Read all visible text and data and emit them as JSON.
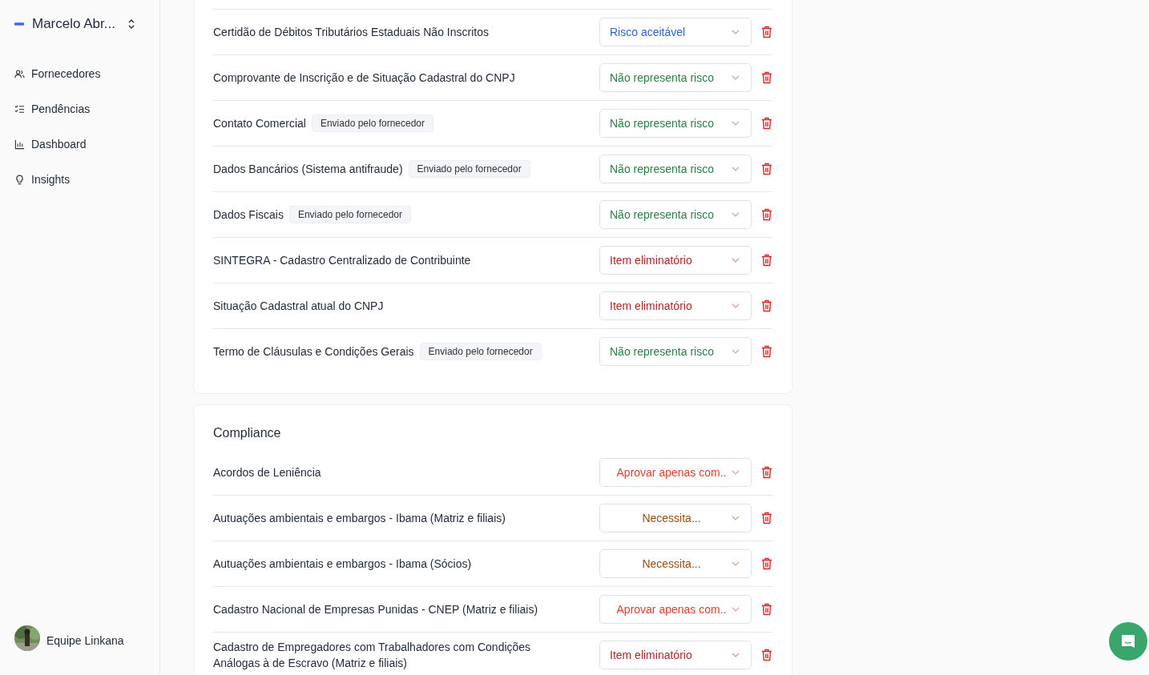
{
  "sidebar": {
    "account": "Marcelo Abr...",
    "items": [
      {
        "label": "Fornecedores",
        "kind": "users",
        "selected": false
      },
      {
        "label": "Pendências",
        "kind": "checklist",
        "selected": false
      },
      {
        "label": "Dashboard",
        "kind": "chart",
        "selected": false
      },
      {
        "label": "Insights",
        "kind": "bulb",
        "selected": false
      }
    ],
    "user": {
      "name": "Equipe Linkana"
    }
  },
  "sections": [
    {
      "items": [
        {
          "name": "Certidão de Débitos Tributários Estaduais Não Inscritos",
          "risk": "Risco aceitável",
          "kind": "acceptable"
        },
        {
          "name": "Comprovante de Inscrição e de Situação Cadastral do CNPJ",
          "risk": "Não representa risco",
          "kind": "no_risk"
        },
        {
          "name": "Contato Comercial",
          "badge": "Enviado pelo fornecedor",
          "risk": "Não representa risco",
          "kind": "no_risk"
        },
        {
          "name": "Dados Bancários (Sistema antifraude)",
          "badge": "Enviado pelo fornecedor",
          "risk": "Não representa risco",
          "kind": "no_risk"
        },
        {
          "name": "Dados Fiscais",
          "badge": "Enviado pelo fornecedor",
          "risk": "Não representa risco",
          "kind": "no_risk"
        },
        {
          "name": "SINTEGRA - Cadastro Centralizado de Contribuinte",
          "risk": "Item eliminatório",
          "kind": "eliminatory"
        },
        {
          "name": "Situação Cadastral atual do CNPJ",
          "risk": "Item eliminatório",
          "kind": "eliminatory"
        },
        {
          "name": "Termo de Cláusulas e Condições Gerais",
          "badge": "Enviado pelo fornecedor",
          "risk": "Não representa risco",
          "kind": "no_risk"
        }
      ]
    },
    {
      "title": "Compliance",
      "items": [
        {
          "name": "Acordos de Leniência",
          "risk": "Aprovar apenas com..",
          "kind": "conditional"
        },
        {
          "name": "Autuações ambientais e embargos - Ibama (Matriz e filiais)",
          "risk": "Necessita...",
          "kind": "needs"
        },
        {
          "name": "Autuações ambientais e embargos - Ibama (Sócios)",
          "risk": "Necessita...",
          "kind": "needs"
        },
        {
          "name": "Cadastro Nacional de Empresas Punidas - CNEP (Matriz e filiais)",
          "risk": "Aprovar apenas com..",
          "kind": "conditional"
        },
        {
          "name": "Cadastro de Empregadores com Trabalhadores com Condições Análogas à de Escravo (Matriz e filiais)",
          "risk": "Item eliminatório",
          "kind": "eliminatory"
        }
      ]
    }
  ]
}
